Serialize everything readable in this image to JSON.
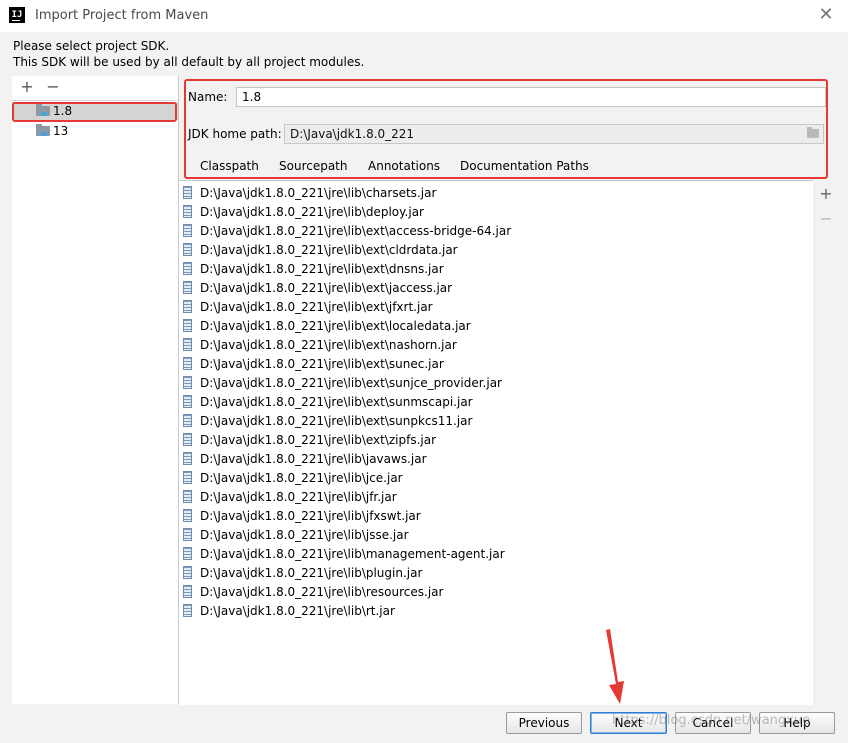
{
  "window": {
    "title": "Import Project from Maven",
    "app_icon_text": "IJ",
    "close_glyph": "✕"
  },
  "prompt": {
    "line1": "Please select project SDK.",
    "line2": "This SDK will be used by all default by all project modules."
  },
  "sdk_list": {
    "add_glyph": "+",
    "remove_glyph": "−",
    "items": [
      {
        "label": "1.8",
        "selected": true
      },
      {
        "label": "13",
        "selected": false
      }
    ]
  },
  "details": {
    "name_label": "Name:",
    "name_value": "1.8",
    "jdk_home_label": "JDK home path:",
    "jdk_home_value": "D:\\Java\\jdk1.8.0_221",
    "tabs": [
      {
        "label": "Classpath",
        "active": true
      },
      {
        "label": "Sourcepath",
        "active": false
      },
      {
        "label": "Annotations",
        "active": false
      },
      {
        "label": "Documentation Paths",
        "active": false
      }
    ]
  },
  "classpath": [
    "D:\\Java\\jdk1.8.0_221\\jre\\lib\\charsets.jar",
    "D:\\Java\\jdk1.8.0_221\\jre\\lib\\deploy.jar",
    "D:\\Java\\jdk1.8.0_221\\jre\\lib\\ext\\access-bridge-64.jar",
    "D:\\Java\\jdk1.8.0_221\\jre\\lib\\ext\\cldrdata.jar",
    "D:\\Java\\jdk1.8.0_221\\jre\\lib\\ext\\dnsns.jar",
    "D:\\Java\\jdk1.8.0_221\\jre\\lib\\ext\\jaccess.jar",
    "D:\\Java\\jdk1.8.0_221\\jre\\lib\\ext\\jfxrt.jar",
    "D:\\Java\\jdk1.8.0_221\\jre\\lib\\ext\\localedata.jar",
    "D:\\Java\\jdk1.8.0_221\\jre\\lib\\ext\\nashorn.jar",
    "D:\\Java\\jdk1.8.0_221\\jre\\lib\\ext\\sunec.jar",
    "D:\\Java\\jdk1.8.0_221\\jre\\lib\\ext\\sunjce_provider.jar",
    "D:\\Java\\jdk1.8.0_221\\jre\\lib\\ext\\sunmscapi.jar",
    "D:\\Java\\jdk1.8.0_221\\jre\\lib\\ext\\sunpkcs11.jar",
    "D:\\Java\\jdk1.8.0_221\\jre\\lib\\ext\\zipfs.jar",
    "D:\\Java\\jdk1.8.0_221\\jre\\lib\\javaws.jar",
    "D:\\Java\\jdk1.8.0_221\\jre\\lib\\jce.jar",
    "D:\\Java\\jdk1.8.0_221\\jre\\lib\\jfr.jar",
    "D:\\Java\\jdk1.8.0_221\\jre\\lib\\jfxswt.jar",
    "D:\\Java\\jdk1.8.0_221\\jre\\lib\\jsse.jar",
    "D:\\Java\\jdk1.8.0_221\\jre\\lib\\management-agent.jar",
    "D:\\Java\\jdk1.8.0_221\\jre\\lib\\plugin.jar",
    "D:\\Java\\jdk1.8.0_221\\jre\\lib\\resources.jar",
    "D:\\Java\\jdk1.8.0_221\\jre\\lib\\rt.jar"
  ],
  "classpath_side": {
    "add_glyph": "+",
    "remove_glyph": "−"
  },
  "buttons": {
    "previous": "Previous",
    "next": "Next",
    "cancel": "Cancel",
    "help": "Help"
  },
  "watermark": "https://blog.csdn.net/wangxue",
  "colors": {
    "annotation_red": "#e53935",
    "accent_blue": "#2d7ed3",
    "window_bg": "#f2f2f2"
  },
  "icons": {
    "sdk_item": "jdk-folder-icon",
    "classpath_item": "jar-icon",
    "browse": "folder-browse-icon"
  }
}
